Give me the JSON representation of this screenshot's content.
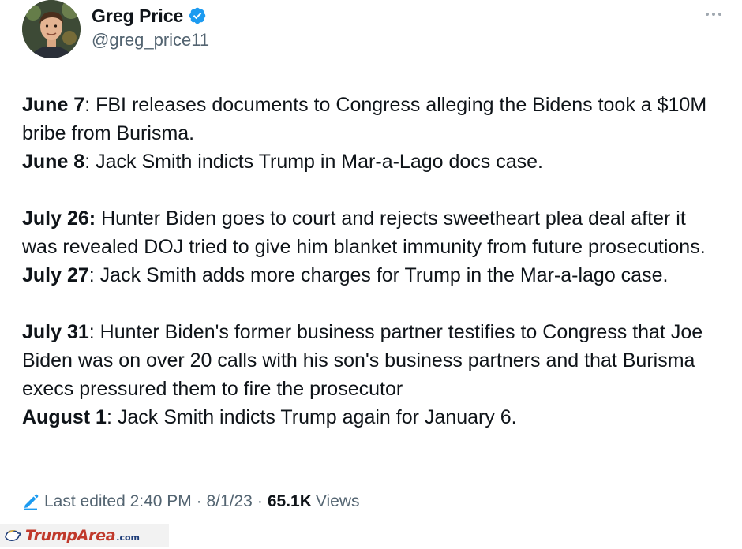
{
  "author": {
    "display_name": "Greg Price",
    "handle": "@greg_price11",
    "verified": true,
    "verified_color": "#1d9bf0"
  },
  "tweet": {
    "paragraphs": [
      [
        {
          "date": "June 7",
          "sep": ":",
          "text": " FBI releases documents to Congress alleging the Bidens took a $10M bribe from Burisma."
        },
        {
          "date": "June 8",
          "sep": ":",
          "text": " Jack Smith indicts Trump in Mar-a-Lago docs case."
        }
      ],
      [
        {
          "date": "July 26:",
          "sep": "",
          "text": " Hunter Biden goes to court and rejects sweetheart plea deal after it was revealed DOJ tried to give him blanket immunity from future prosecutions."
        },
        {
          "date": "July 27",
          "sep": ":",
          "text": " Jack Smith adds more charges for Trump in the Mar-a-lago case."
        }
      ],
      [
        {
          "date": "July 31",
          "sep": ":",
          "text": " Hunter Biden's former business partner testifies to Congress that Joe Biden was on over 20 calls with his son's business partners and that Burisma execs pressured them to fire the prosecutor"
        },
        {
          "date": "August 1",
          "sep": ":",
          "text": " Jack Smith indicts Trump again for January 6."
        }
      ]
    ]
  },
  "meta": {
    "edited_label": "Last edited 2:40 PM · 8/1/23",
    "separator": "·",
    "views_count": "65.1K",
    "views_label": "Views"
  },
  "watermark": {
    "brand": "TrumpArea",
    "suffix": ".com",
    "brand_color": "#c0392b"
  },
  "colors": {
    "text_primary": "#0f1419",
    "text_secondary": "#536471",
    "accent": "#1d9bf0"
  },
  "icons": {
    "more": "more-horizontal-icon",
    "verified": "verified-badge-icon",
    "edit": "pencil-icon"
  }
}
